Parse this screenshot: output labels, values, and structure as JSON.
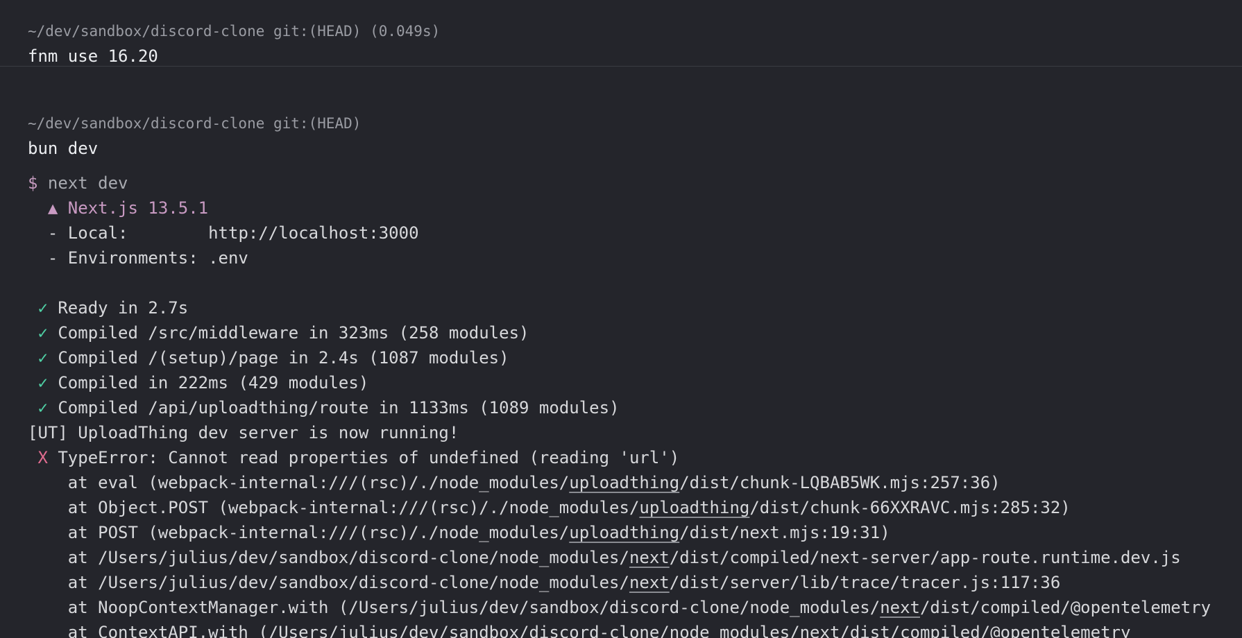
{
  "block1": {
    "prompt": "~/dev/sandbox/discord-clone git:(HEAD) (0.049s)",
    "command": "fnm use 16.20"
  },
  "block2": {
    "prompt": "~/dev/sandbox/discord-clone git:(HEAD)",
    "command": "bun dev"
  },
  "output": {
    "dollar": "$",
    "next_dev": " next dev",
    "triangle": "  ▲",
    "nextjs_version": " Next.js 13.5.1",
    "local_label": "  - Local:        ",
    "local_url": "http://localhost:3000",
    "env_line": "  - Environments: .env",
    "checks": [
      " Ready in 2.7s",
      " Compiled /src/middleware in 323ms (258 modules)",
      " Compiled /(setup)/page in 2.4s (1087 modules)",
      " Compiled in 222ms (429 modules)",
      " Compiled /api/uploadthing/route in 1133ms (1089 modules)"
    ],
    "check_mark": " ✓",
    "ut_line": "[UT] UploadThing dev server is now running!",
    "x_mark": " X",
    "type_error": " TypeError: Cannot read properties of undefined (reading 'url')",
    "stack": [
      {
        "pre": "    at eval (webpack-internal:///(rsc)/./node_modules/",
        "link": "uploadthing",
        "post": "/dist/chunk-LQBAB5WK.mjs:257:36)"
      },
      {
        "pre": "    at Object.POST (webpack-internal:///(rsc)/./node_modules/",
        "link": "uploadthing",
        "post": "/dist/chunk-66XXRAVC.mjs:285:32)"
      },
      {
        "pre": "    at POST (webpack-internal:///(rsc)/./node_modules/",
        "link": "uploadthing",
        "post": "/dist/next.mjs:19:31)"
      },
      {
        "pre": "    at /Users/julius/dev/sandbox/discord-clone/node_modules/",
        "link": "next",
        "post": "/dist/compiled/next-server/app-route.runtime.dev.js"
      },
      {
        "pre": "    at /Users/julius/dev/sandbox/discord-clone/node_modules/",
        "link": "next",
        "post": "/dist/server/lib/trace/tracer.js:117:36"
      },
      {
        "pre": "    at NoopContextManager.with (/Users/julius/dev/sandbox/discord-clone/node_modules/",
        "link": "next",
        "post": "/dist/compiled/@opentelemetry"
      },
      {
        "pre": "    at ContextAPI.with (/Users/julius/dev/sandbox/discord-clone/node_modules/",
        "link": "next",
        "post": "/dist/compiled/@opentelemetry"
      }
    ]
  }
}
